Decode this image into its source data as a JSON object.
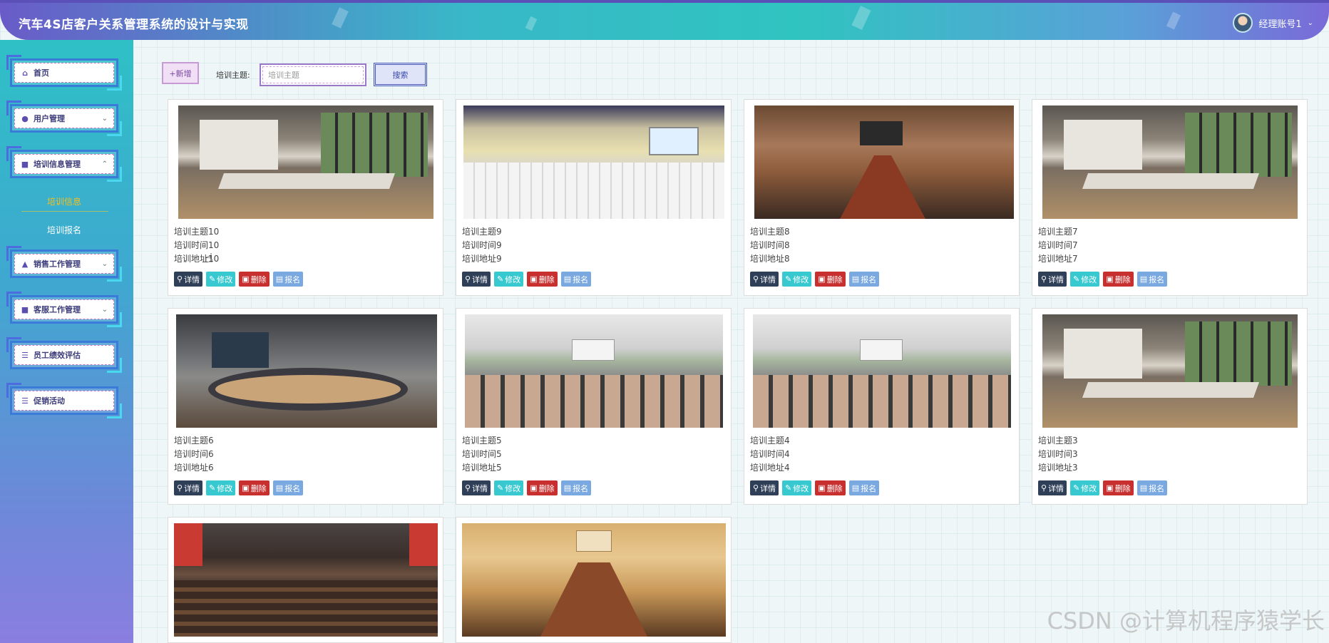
{
  "header": {
    "title": "汽车4S店客户关系管理系统的设计与实现",
    "user_label": "经理账号1"
  },
  "sidebar": {
    "items": [
      {
        "label": "首页",
        "icon": "home-icon"
      },
      {
        "label": "用户管理",
        "icon": "user-icon"
      },
      {
        "label": "培训信息管理",
        "icon": "folder-icon"
      },
      {
        "label": "销售工作管理",
        "icon": "bank-icon"
      },
      {
        "label": "客服工作管理",
        "icon": "folder-icon"
      },
      {
        "label": "员工绩效评估",
        "icon": "list-icon"
      },
      {
        "label": "促销活动",
        "icon": "list-icon"
      }
    ],
    "sub_items": [
      {
        "label": "培训信息"
      },
      {
        "label": "培训报名"
      }
    ]
  },
  "toolbar": {
    "add_label": "+新增",
    "search_label": "培训主题:",
    "search_placeholder": "培训主题",
    "search_button": "搜索"
  },
  "card_actions": {
    "detail": "详情",
    "edit": "修改",
    "delete": "删除",
    "signup": "报名"
  },
  "cards": [
    {
      "topic": "培训主题10",
      "time": "培训时间10",
      "addr": "培训地址10"
    },
    {
      "topic": "培训主题9",
      "time": "培训时间9",
      "addr": "培训地址9"
    },
    {
      "topic": "培训主题8",
      "time": "培训时间8",
      "addr": "培训地址8"
    },
    {
      "topic": "培训主题7",
      "time": "培训时间7",
      "addr": "培训地址7"
    },
    {
      "topic": "培训主题6",
      "time": "培训时间6",
      "addr": "培训地址6"
    },
    {
      "topic": "培训主题5",
      "time": "培训时间5",
      "addr": "培训地址5"
    },
    {
      "topic": "培训主题4",
      "time": "培训时间4",
      "addr": "培训地址4"
    },
    {
      "topic": "培训主题3",
      "time": "培训时间3",
      "addr": "培训地址3"
    }
  ],
  "watermark": "CSDN @计算机程序猿学长"
}
